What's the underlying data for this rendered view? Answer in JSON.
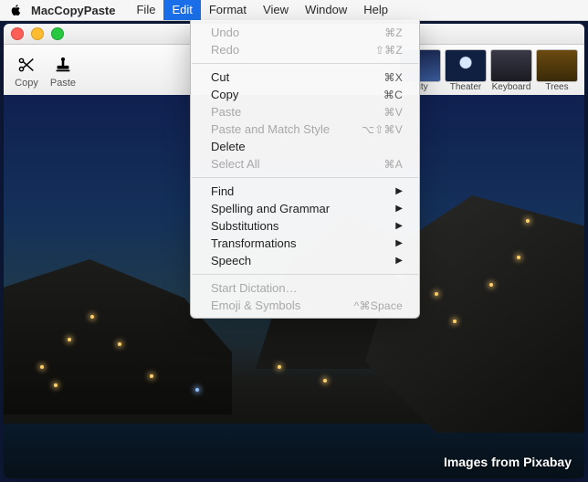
{
  "menubar": {
    "app_name": "MacCopyPaste",
    "items": [
      "File",
      "Edit",
      "Format",
      "View",
      "Window",
      "Help"
    ],
    "active_index": 1
  },
  "toolbar": {
    "buttons": [
      {
        "name": "copy",
        "label": "Copy",
        "icon": "scissors-icon"
      },
      {
        "name": "paste",
        "label": "Paste",
        "icon": "stamp-icon"
      }
    ],
    "thumbs": [
      {
        "name": "city",
        "label": "City"
      },
      {
        "name": "theater",
        "label": "Theater"
      },
      {
        "name": "keyboard",
        "label": "Keyboard"
      },
      {
        "name": "trees",
        "label": "Trees"
      }
    ]
  },
  "edit_menu": [
    {
      "label": "Undo",
      "shortcut": "⌘Z",
      "enabled": false
    },
    {
      "label": "Redo",
      "shortcut": "⇧⌘Z",
      "enabled": false
    },
    {
      "separator": true
    },
    {
      "label": "Cut",
      "shortcut": "⌘X",
      "enabled": true
    },
    {
      "label": "Copy",
      "shortcut": "⌘C",
      "enabled": true
    },
    {
      "label": "Paste",
      "shortcut": "⌘V",
      "enabled": false
    },
    {
      "label": "Paste and Match Style",
      "shortcut": "⌥⇧⌘V",
      "enabled": false
    },
    {
      "label": "Delete",
      "shortcut": "",
      "enabled": true
    },
    {
      "label": "Select All",
      "shortcut": "⌘A",
      "enabled": false
    },
    {
      "separator": true
    },
    {
      "label": "Find",
      "submenu": true,
      "enabled": true
    },
    {
      "label": "Spelling and Grammar",
      "submenu": true,
      "enabled": true
    },
    {
      "label": "Substitutions",
      "submenu": true,
      "enabled": true
    },
    {
      "label": "Transformations",
      "submenu": true,
      "enabled": true
    },
    {
      "label": "Speech",
      "submenu": true,
      "enabled": true
    },
    {
      "separator": true
    },
    {
      "label": "Start Dictation…",
      "shortcut": "",
      "enabled": false
    },
    {
      "label": "Emoji & Symbols",
      "shortcut": "^⌘Space",
      "enabled": false
    }
  ],
  "credit_text": "Images from Pixabay"
}
